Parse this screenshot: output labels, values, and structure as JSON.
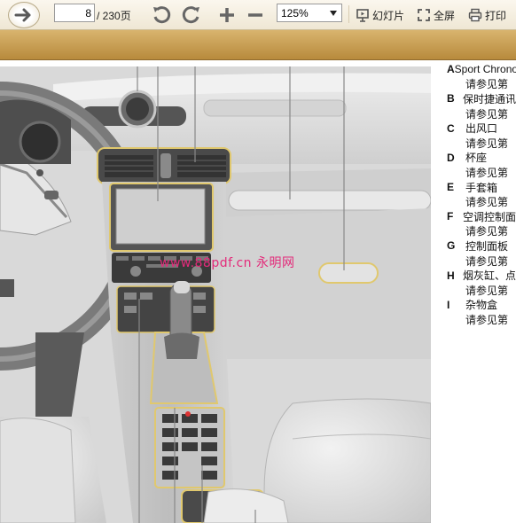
{
  "toolbar": {
    "back_icon": "arrow-right-icon",
    "current_page": "8",
    "total_pages": "/ 230页",
    "rotate_left_icon": "rotate-ccw-icon",
    "rotate_right_icon": "rotate-cw-icon",
    "zoom_in_icon": "plus-icon",
    "zoom_out_icon": "minus-icon",
    "zoom_value": "125%",
    "slideshow_label": "幻灯片",
    "fullscreen_label": "全屏",
    "print_label": "打印"
  },
  "colors": {
    "toolbar_bg": "#f3ecdc",
    "band": "#c9a25a",
    "watermark": "#e32a7a"
  },
  "legend": [
    {
      "letter": "A",
      "text": "Sport Chrono",
      "sub": "请参见第"
    },
    {
      "letter": "B",
      "text": "保时捷通讯",
      "sub": "请参见第"
    },
    {
      "letter": "C",
      "text": "出风口",
      "sub": "请参见第"
    },
    {
      "letter": "D",
      "text": "杯座",
      "sub": "请参见第"
    },
    {
      "letter": "E",
      "text": "手套箱",
      "sub": "请参见第"
    },
    {
      "letter": "F",
      "text": "空调控制面",
      "sub": "请参见第"
    },
    {
      "letter": "G",
      "text": "控制面板",
      "sub": "请参见第"
    },
    {
      "letter": "H",
      "text": "烟灰缸、点",
      "sub": "请参见第"
    },
    {
      "letter": "I",
      "text": "杂物盒",
      "sub": "请参见第"
    }
  ],
  "watermark": "www.88pdf.cn  永明网"
}
